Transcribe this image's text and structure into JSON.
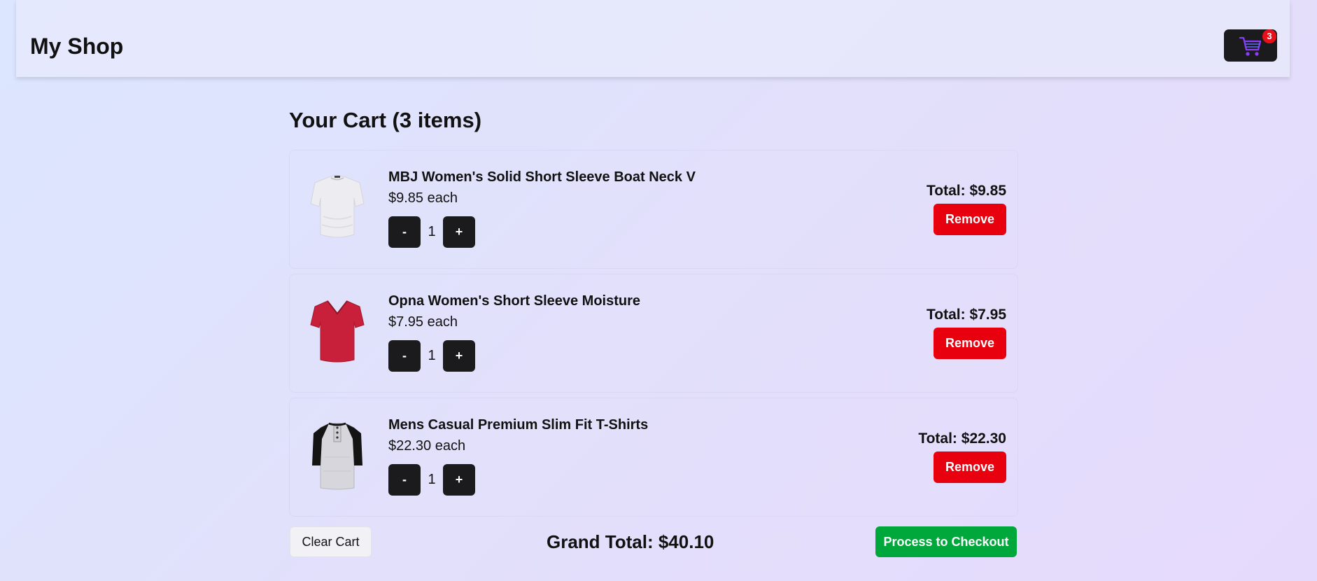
{
  "header": {
    "title": "My Shop",
    "cart_icon": "shopping-cart-icon",
    "cart_count": "3",
    "colors": {
      "cart_button_bg": "#1b1b1d",
      "cart_icon": "#8b3dff",
      "badge": "#e8101a"
    }
  },
  "cart": {
    "title": "Your Cart (3 items)",
    "items": [
      {
        "name": "MBJ Women's Solid Short Sleeve Boat Neck V",
        "price": "$9.85 each",
        "quantity": "1",
        "minus_label": "-",
        "plus_label": "+",
        "total": "Total: $9.85",
        "remove_label": "Remove",
        "image": "white-womens-tshirt"
      },
      {
        "name": "Opna Women's Short Sleeve Moisture",
        "price": "$7.95 each",
        "quantity": "1",
        "minus_label": "-",
        "plus_label": "+",
        "total": "Total: $7.95",
        "remove_label": "Remove",
        "image": "red-vneck-tshirt"
      },
      {
        "name": "Mens Casual Premium Slim Fit T-Shirts",
        "price": "$22.30 each",
        "quantity": "1",
        "minus_label": "-",
        "plus_label": "+",
        "total": "Total: $22.30",
        "remove_label": "Remove",
        "image": "gray-black-raglan-henley"
      }
    ]
  },
  "footer": {
    "clear_label": "Clear Cart",
    "grand_total": "Grand Total: $40.10",
    "checkout_label": "Process to Checkout"
  },
  "colors": {
    "remove": "#e8000f",
    "checkout": "#00a83c",
    "qty_button": "#1b1b1d"
  }
}
